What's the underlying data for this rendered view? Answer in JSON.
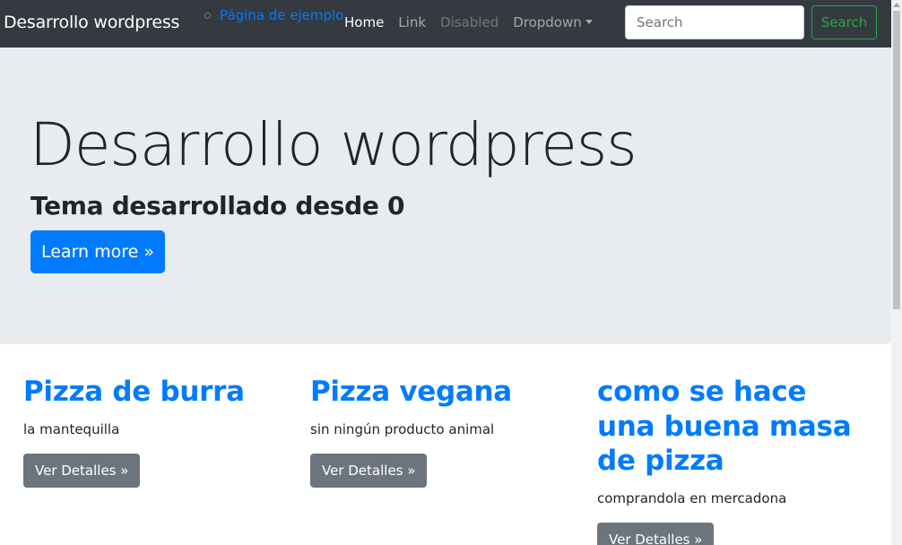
{
  "navbar": {
    "brand": "Desarrollo wordpress",
    "page_link": "Página de ejemplo",
    "items": [
      {
        "label": "Home"
      },
      {
        "label": "Link"
      },
      {
        "label": "Disabled"
      },
      {
        "label": "Dropdown"
      }
    ],
    "search": {
      "placeholder": "Search",
      "button_label": "Search"
    }
  },
  "jumbotron": {
    "title": "Desarrollo wordpress",
    "subtitle": "Tema desarrollado desde 0",
    "button_label": "Learn more »"
  },
  "cards": [
    {
      "title": "Pizza de burra",
      "text": "la mantequilla",
      "button_label": "Ver Detalles »"
    },
    {
      "title": "Pizza vegana",
      "text": "sin ningún producto animal",
      "button_label": "Ver Detalles »"
    },
    {
      "title": "como se hace una buena masa de pizza",
      "text": "comprandola en mercadona",
      "button_label": "Ver Detalles »"
    }
  ],
  "colors": {
    "navbar_bg": "#343a40",
    "primary": "#007bff",
    "success": "#28a745",
    "secondary": "#6c757d",
    "jumbotron_bg": "#e9ecef"
  }
}
